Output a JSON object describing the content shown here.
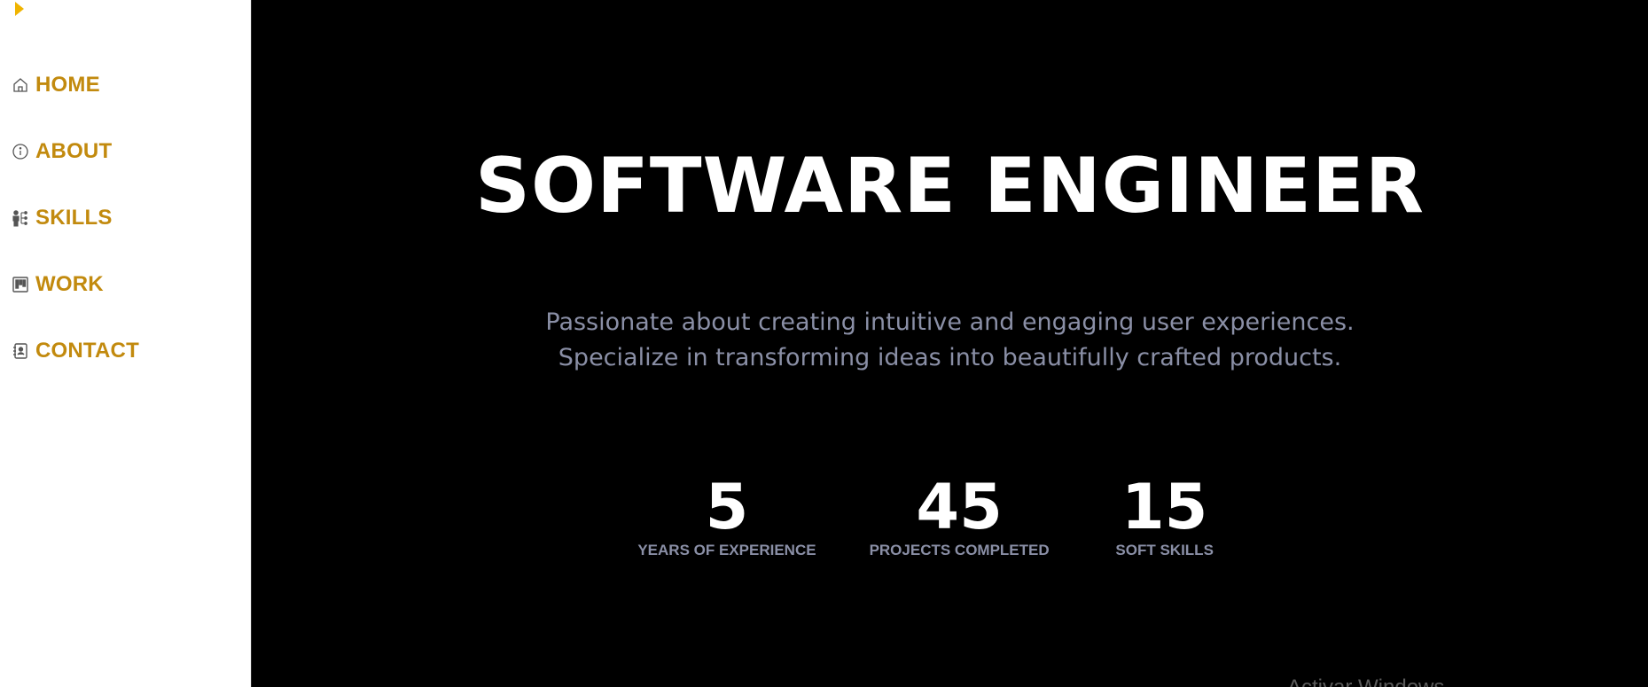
{
  "sidebar": {
    "toggle_icon": "caret-right-icon",
    "accent_color": "#c28a0e",
    "toggle_color": "#f0b400",
    "items": [
      {
        "label": "HOME",
        "icon": "home-icon"
      },
      {
        "label": "ABOUT",
        "icon": "info-icon"
      },
      {
        "label": "SKILLS",
        "icon": "skills-icon"
      },
      {
        "label": "WORK",
        "icon": "kanban-board-icon"
      },
      {
        "label": "CONTACT",
        "icon": "contact-book-icon"
      }
    ]
  },
  "hero": {
    "title": "SOFTWARE ENGINEER",
    "subtitle_line1": "Passionate about creating intuitive and engaging user experiences.",
    "subtitle_line2": "Specialize in transforming ideas into beautifully crafted products."
  },
  "stats": [
    {
      "value": "5",
      "label": "YEARS OF EXPERIENCE"
    },
    {
      "value": "45",
      "label": "PROJECTS COMPLETED"
    },
    {
      "value": "15",
      "label": "SOFT SKILLS"
    }
  ],
  "overlay": {
    "watermark_text": "Activar Windows"
  },
  "colors": {
    "main_bg": "#000000",
    "title": "#ffffff",
    "muted_text": "#8a8fa6"
  }
}
